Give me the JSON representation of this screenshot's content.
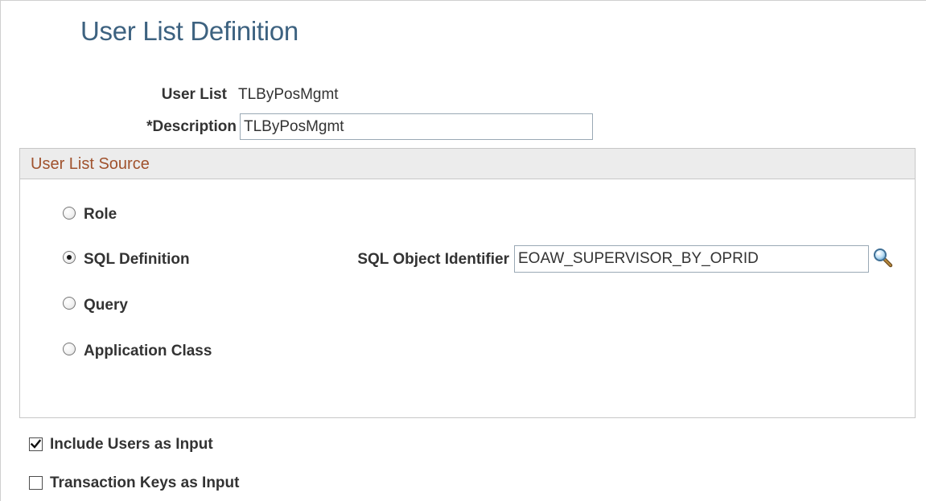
{
  "page": {
    "title": "User List Definition"
  },
  "user_list": {
    "label": "User List",
    "value": "TLByPosMgmt"
  },
  "description": {
    "label": "*Description",
    "value": "TLByPosMgmt"
  },
  "source_section": {
    "title": "User List Source",
    "options": [
      {
        "label": "Role",
        "selected": false
      },
      {
        "label": "SQL Definition",
        "selected": true
      },
      {
        "label": "Query",
        "selected": false
      },
      {
        "label": "Application Class",
        "selected": false
      }
    ],
    "sql_object": {
      "label": "SQL Object Identifier",
      "value": "EOAW_SUPERVISOR_BY_OPRID",
      "lookup_icon": "magnifier-icon"
    }
  },
  "checkboxes": [
    {
      "label": "Include Users as Input",
      "checked": true
    },
    {
      "label": "Transaction Keys as Input",
      "checked": false
    }
  ],
  "colors": {
    "title": "#3d6280",
    "section_title": "#a0522d",
    "section_header_bg": "#ececec"
  }
}
